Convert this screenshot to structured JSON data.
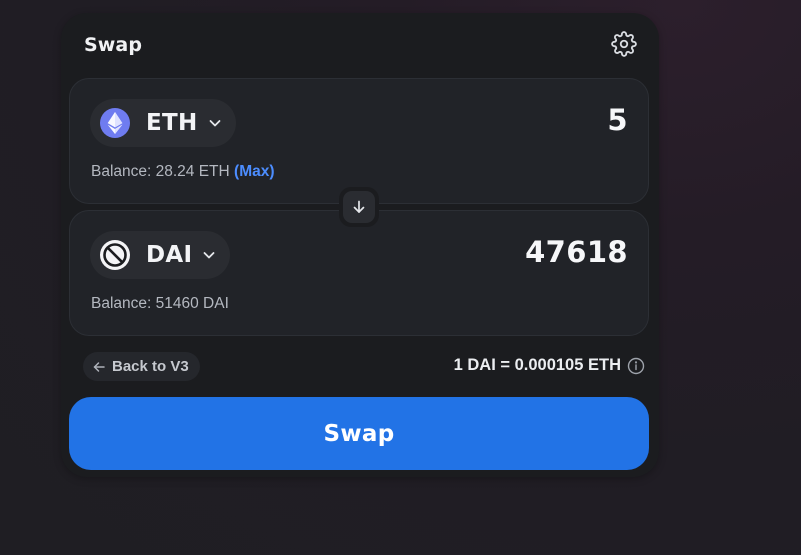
{
  "header": {
    "title": "Swap",
    "settings_icon": "gear-icon"
  },
  "sell": {
    "token_symbol": "ETH",
    "token_icon": "ethereum-icon",
    "amount": "5",
    "balance_text": "Balance: 28.24 ETH",
    "max_label": "(Max)"
  },
  "switch": {
    "icon": "arrow-down-icon"
  },
  "buy": {
    "token_symbol": "DAI",
    "token_icon": "dai-icon",
    "amount": "47618",
    "balance_text": "Balance: 51460 DAI"
  },
  "footer": {
    "back_label": "Back to V3",
    "rate_text": "1 DAI = 0.000105 ETH"
  },
  "action": {
    "swap_label": "Swap"
  },
  "colors": {
    "accent": "#2273e6",
    "max_link": "#4c8dff",
    "eth_icon": "#6f7cf0"
  }
}
